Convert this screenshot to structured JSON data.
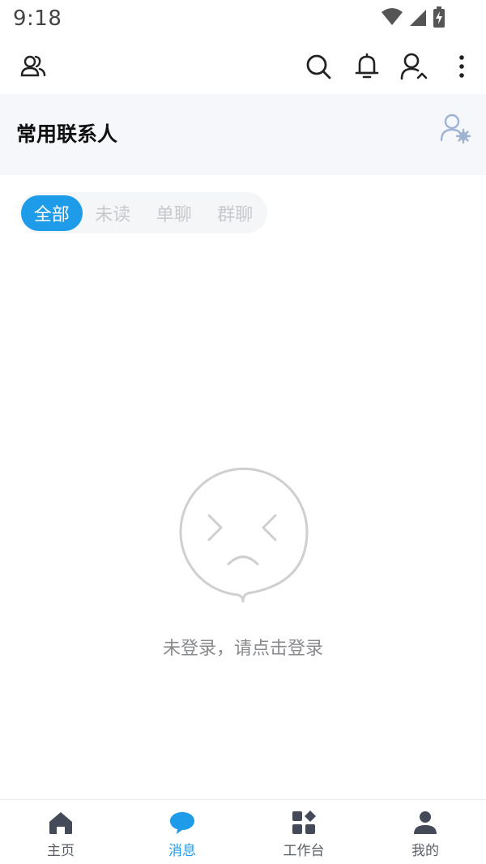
{
  "status_bar": {
    "time": "9:18",
    "icons": [
      "wifi-icon",
      "cellular-signal-icon",
      "battery-charging-icon"
    ]
  },
  "app_bar": {
    "left_icon": "contacts-icon",
    "right_icons": [
      "search-icon",
      "bell-icon",
      "user-icon",
      "more-vertical-icon"
    ]
  },
  "contacts": {
    "title": "常用联系人",
    "settings_icon": "user-settings-icon"
  },
  "filter_tabs": [
    {
      "label": "全部",
      "active": true
    },
    {
      "label": "未读",
      "active": false
    },
    {
      "label": "单聊",
      "active": false
    },
    {
      "label": "群聊",
      "active": false
    }
  ],
  "empty_state": {
    "icon": "sad-face-icon",
    "message": "未登录，请点击登录"
  },
  "bottom_nav": [
    {
      "label": "主页",
      "icon": "home-icon",
      "active": false
    },
    {
      "label": "消息",
      "icon": "chat-icon",
      "active": true
    },
    {
      "label": "工作台",
      "icon": "apps-grid-icon",
      "active": false
    },
    {
      "label": "我的",
      "icon": "person-icon",
      "active": false
    }
  ],
  "colors": {
    "accent": "#1e9be9",
    "icon_dark": "#444a58",
    "inactive_tab_text": "#c7c9cd",
    "empty_text": "#888a8e",
    "card_background": "#f6f7fa"
  }
}
